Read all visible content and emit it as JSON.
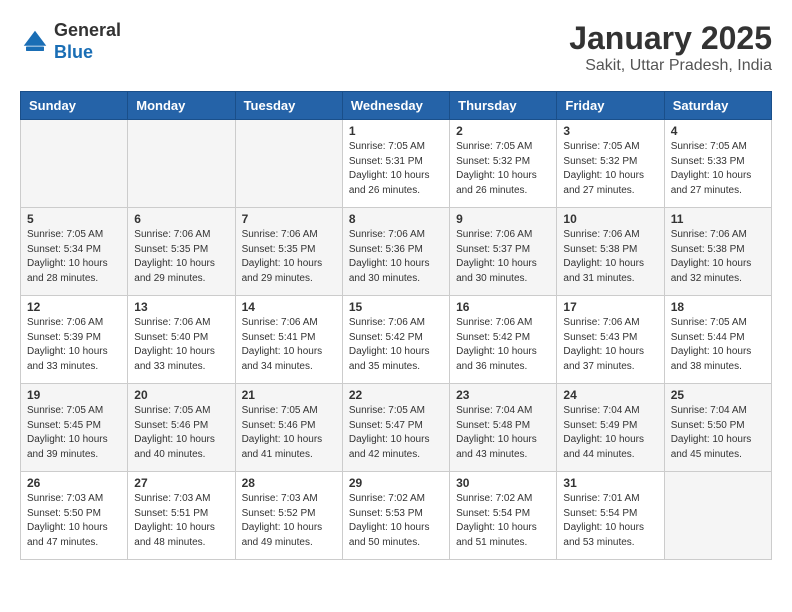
{
  "logo": {
    "general": "General",
    "blue": "Blue"
  },
  "title": "January 2025",
  "subtitle": "Sakit, Uttar Pradesh, India",
  "weekdays": [
    "Sunday",
    "Monday",
    "Tuesday",
    "Wednesday",
    "Thursday",
    "Friday",
    "Saturday"
  ],
  "weeks": [
    [
      {
        "day": "",
        "info": ""
      },
      {
        "day": "",
        "info": ""
      },
      {
        "day": "",
        "info": ""
      },
      {
        "day": "1",
        "info": "Sunrise: 7:05 AM\nSunset: 5:31 PM\nDaylight: 10 hours\nand 26 minutes."
      },
      {
        "day": "2",
        "info": "Sunrise: 7:05 AM\nSunset: 5:32 PM\nDaylight: 10 hours\nand 26 minutes."
      },
      {
        "day": "3",
        "info": "Sunrise: 7:05 AM\nSunset: 5:32 PM\nDaylight: 10 hours\nand 27 minutes."
      },
      {
        "day": "4",
        "info": "Sunrise: 7:05 AM\nSunset: 5:33 PM\nDaylight: 10 hours\nand 27 minutes."
      }
    ],
    [
      {
        "day": "5",
        "info": "Sunrise: 7:05 AM\nSunset: 5:34 PM\nDaylight: 10 hours\nand 28 minutes."
      },
      {
        "day": "6",
        "info": "Sunrise: 7:06 AM\nSunset: 5:35 PM\nDaylight: 10 hours\nand 29 minutes."
      },
      {
        "day": "7",
        "info": "Sunrise: 7:06 AM\nSunset: 5:35 PM\nDaylight: 10 hours\nand 29 minutes."
      },
      {
        "day": "8",
        "info": "Sunrise: 7:06 AM\nSunset: 5:36 PM\nDaylight: 10 hours\nand 30 minutes."
      },
      {
        "day": "9",
        "info": "Sunrise: 7:06 AM\nSunset: 5:37 PM\nDaylight: 10 hours\nand 30 minutes."
      },
      {
        "day": "10",
        "info": "Sunrise: 7:06 AM\nSunset: 5:38 PM\nDaylight: 10 hours\nand 31 minutes."
      },
      {
        "day": "11",
        "info": "Sunrise: 7:06 AM\nSunset: 5:38 PM\nDaylight: 10 hours\nand 32 minutes."
      }
    ],
    [
      {
        "day": "12",
        "info": "Sunrise: 7:06 AM\nSunset: 5:39 PM\nDaylight: 10 hours\nand 33 minutes."
      },
      {
        "day": "13",
        "info": "Sunrise: 7:06 AM\nSunset: 5:40 PM\nDaylight: 10 hours\nand 33 minutes."
      },
      {
        "day": "14",
        "info": "Sunrise: 7:06 AM\nSunset: 5:41 PM\nDaylight: 10 hours\nand 34 minutes."
      },
      {
        "day": "15",
        "info": "Sunrise: 7:06 AM\nSunset: 5:42 PM\nDaylight: 10 hours\nand 35 minutes."
      },
      {
        "day": "16",
        "info": "Sunrise: 7:06 AM\nSunset: 5:42 PM\nDaylight: 10 hours\nand 36 minutes."
      },
      {
        "day": "17",
        "info": "Sunrise: 7:06 AM\nSunset: 5:43 PM\nDaylight: 10 hours\nand 37 minutes."
      },
      {
        "day": "18",
        "info": "Sunrise: 7:05 AM\nSunset: 5:44 PM\nDaylight: 10 hours\nand 38 minutes."
      }
    ],
    [
      {
        "day": "19",
        "info": "Sunrise: 7:05 AM\nSunset: 5:45 PM\nDaylight: 10 hours\nand 39 minutes."
      },
      {
        "day": "20",
        "info": "Sunrise: 7:05 AM\nSunset: 5:46 PM\nDaylight: 10 hours\nand 40 minutes."
      },
      {
        "day": "21",
        "info": "Sunrise: 7:05 AM\nSunset: 5:46 PM\nDaylight: 10 hours\nand 41 minutes."
      },
      {
        "day": "22",
        "info": "Sunrise: 7:05 AM\nSunset: 5:47 PM\nDaylight: 10 hours\nand 42 minutes."
      },
      {
        "day": "23",
        "info": "Sunrise: 7:04 AM\nSunset: 5:48 PM\nDaylight: 10 hours\nand 43 minutes."
      },
      {
        "day": "24",
        "info": "Sunrise: 7:04 AM\nSunset: 5:49 PM\nDaylight: 10 hours\nand 44 minutes."
      },
      {
        "day": "25",
        "info": "Sunrise: 7:04 AM\nSunset: 5:50 PM\nDaylight: 10 hours\nand 45 minutes."
      }
    ],
    [
      {
        "day": "26",
        "info": "Sunrise: 7:03 AM\nSunset: 5:50 PM\nDaylight: 10 hours\nand 47 minutes."
      },
      {
        "day": "27",
        "info": "Sunrise: 7:03 AM\nSunset: 5:51 PM\nDaylight: 10 hours\nand 48 minutes."
      },
      {
        "day": "28",
        "info": "Sunrise: 7:03 AM\nSunset: 5:52 PM\nDaylight: 10 hours\nand 49 minutes."
      },
      {
        "day": "29",
        "info": "Sunrise: 7:02 AM\nSunset: 5:53 PM\nDaylight: 10 hours\nand 50 minutes."
      },
      {
        "day": "30",
        "info": "Sunrise: 7:02 AM\nSunset: 5:54 PM\nDaylight: 10 hours\nand 51 minutes."
      },
      {
        "day": "31",
        "info": "Sunrise: 7:01 AM\nSunset: 5:54 PM\nDaylight: 10 hours\nand 53 minutes."
      },
      {
        "day": "",
        "info": ""
      }
    ]
  ]
}
